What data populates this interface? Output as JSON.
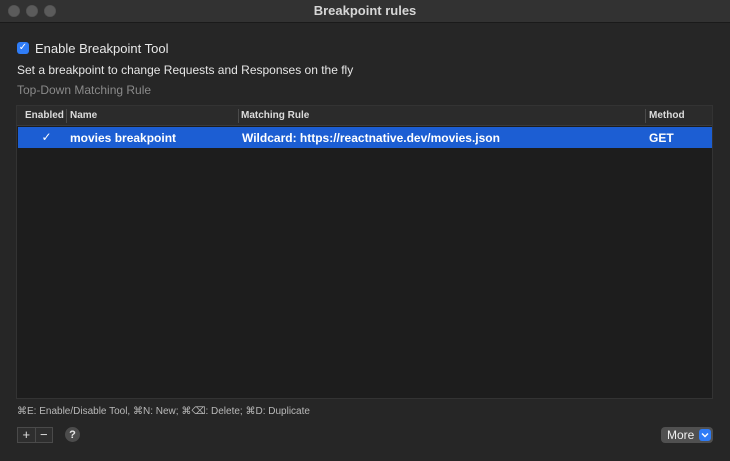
{
  "window": {
    "title": "Breakpoint rules"
  },
  "options": {
    "enable_label": "Enable Breakpoint Tool",
    "enable_checked": true,
    "description": "Set a breakpoint to change Requests and Responses on the fly",
    "section_title": "Top-Down Matching Rule"
  },
  "table": {
    "columns": [
      "Enabled",
      "Name",
      "Matching Rule",
      "Method"
    ],
    "rows": [
      {
        "enabled": true,
        "name": "movies breakpoint",
        "matching_rule": "Wildcard: https://reactnative.dev/movies.json",
        "method": "GET"
      }
    ]
  },
  "footer": {
    "shortcuts": "⌘E: Enable/Disable Tool, ⌘N: New; ⌘⌫: Delete; ⌘D: Duplicate",
    "add_label": "+",
    "remove_label": "−",
    "help_label": "?",
    "more_label": "More"
  },
  "colors": {
    "accent": "#2f7cf6",
    "selected_row": "#1c5ed3",
    "background": "#262626"
  },
  "icons": {
    "close": "close-traffic-light",
    "minimize": "minimize-traffic-light",
    "zoom": "zoom-traffic-light",
    "checkmark": "checkmark-icon",
    "chevron": "chevron-down-icon",
    "help": "help-icon"
  }
}
